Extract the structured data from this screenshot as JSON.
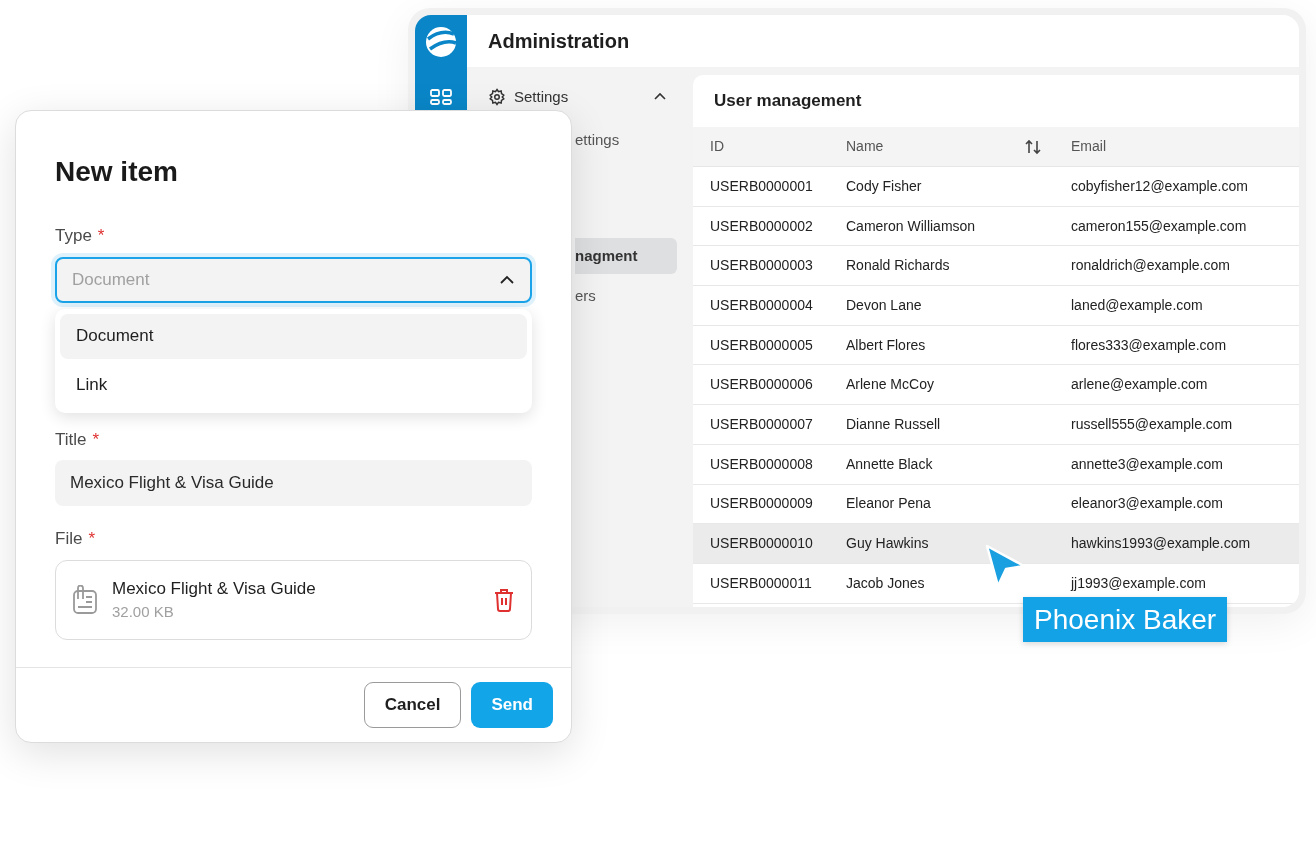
{
  "admin": {
    "title": "Administration",
    "nav": [
      {
        "label": "Settings",
        "expanded": true,
        "children": [
          {
            "label": "ettings",
            "selected": false
          },
          {
            "label": "nagment",
            "selected": true
          },
          {
            "label": "ers",
            "selected": false
          }
        ]
      }
    ],
    "table": {
      "title": "User management",
      "columns": [
        "ID",
        "Name",
        "Email"
      ],
      "rows": [
        {
          "id": "USERB0000001",
          "name": "Cody Fisher",
          "email": "cobyfisher12@example.com",
          "highlighted": false
        },
        {
          "id": "USERB0000002",
          "name": "Cameron Williamson",
          "email": "cameron155@example.com",
          "highlighted": false
        },
        {
          "id": "USERB0000003",
          "name": "Ronald Richards",
          "email": "ronaldrich@example.com",
          "highlighted": false
        },
        {
          "id": "USERB0000004",
          "name": "Devon Lane",
          "email": "laned@example.com",
          "highlighted": false
        },
        {
          "id": "USERB0000005",
          "name": "Albert Flores",
          "email": "flores333@example.com",
          "highlighted": false
        },
        {
          "id": "USERB0000006",
          "name": "Arlene McCoy",
          "email": "arlene@example.com",
          "highlighted": false
        },
        {
          "id": "USERB0000007",
          "name": "Dianne Russell",
          "email": "russell555@example.com",
          "highlighted": false
        },
        {
          "id": "USERB0000008",
          "name": "Annette Black",
          "email": "annette3@example.com",
          "highlighted": false
        },
        {
          "id": "USERB0000009",
          "name": "Eleanor Pena",
          "email": "eleanor3@example.com",
          "highlighted": false
        },
        {
          "id": "USERB0000010",
          "name": "Guy Hawkins",
          "email": "hawkins1993@example.com",
          "highlighted": true
        },
        {
          "id": "USERB0000011",
          "name": "Jacob Jones",
          "email": "jj1993@example.com",
          "highlighted": false
        }
      ]
    }
  },
  "dialog": {
    "title": "New item",
    "type_field": {
      "label": "Type",
      "required_mark": "*",
      "placeholder": "Document",
      "expanded": true,
      "options": [
        {
          "label": "Document",
          "selected": true
        },
        {
          "label": "Link",
          "selected": false
        }
      ]
    },
    "title_field": {
      "label": "Title",
      "required_mark": "*",
      "value": "Mexico Flight & Visa Guide"
    },
    "file_field": {
      "label": "File",
      "required_mark": "*",
      "file_name": "Mexico Flight & Visa Guide",
      "file_size": "32.00 KB"
    },
    "buttons": [
      {
        "label": "Cancel",
        "kind": "secondary"
      },
      {
        "label": "Send",
        "kind": "primary"
      }
    ]
  },
  "cursor_tag": {
    "label": "Phoenix Baker"
  }
}
